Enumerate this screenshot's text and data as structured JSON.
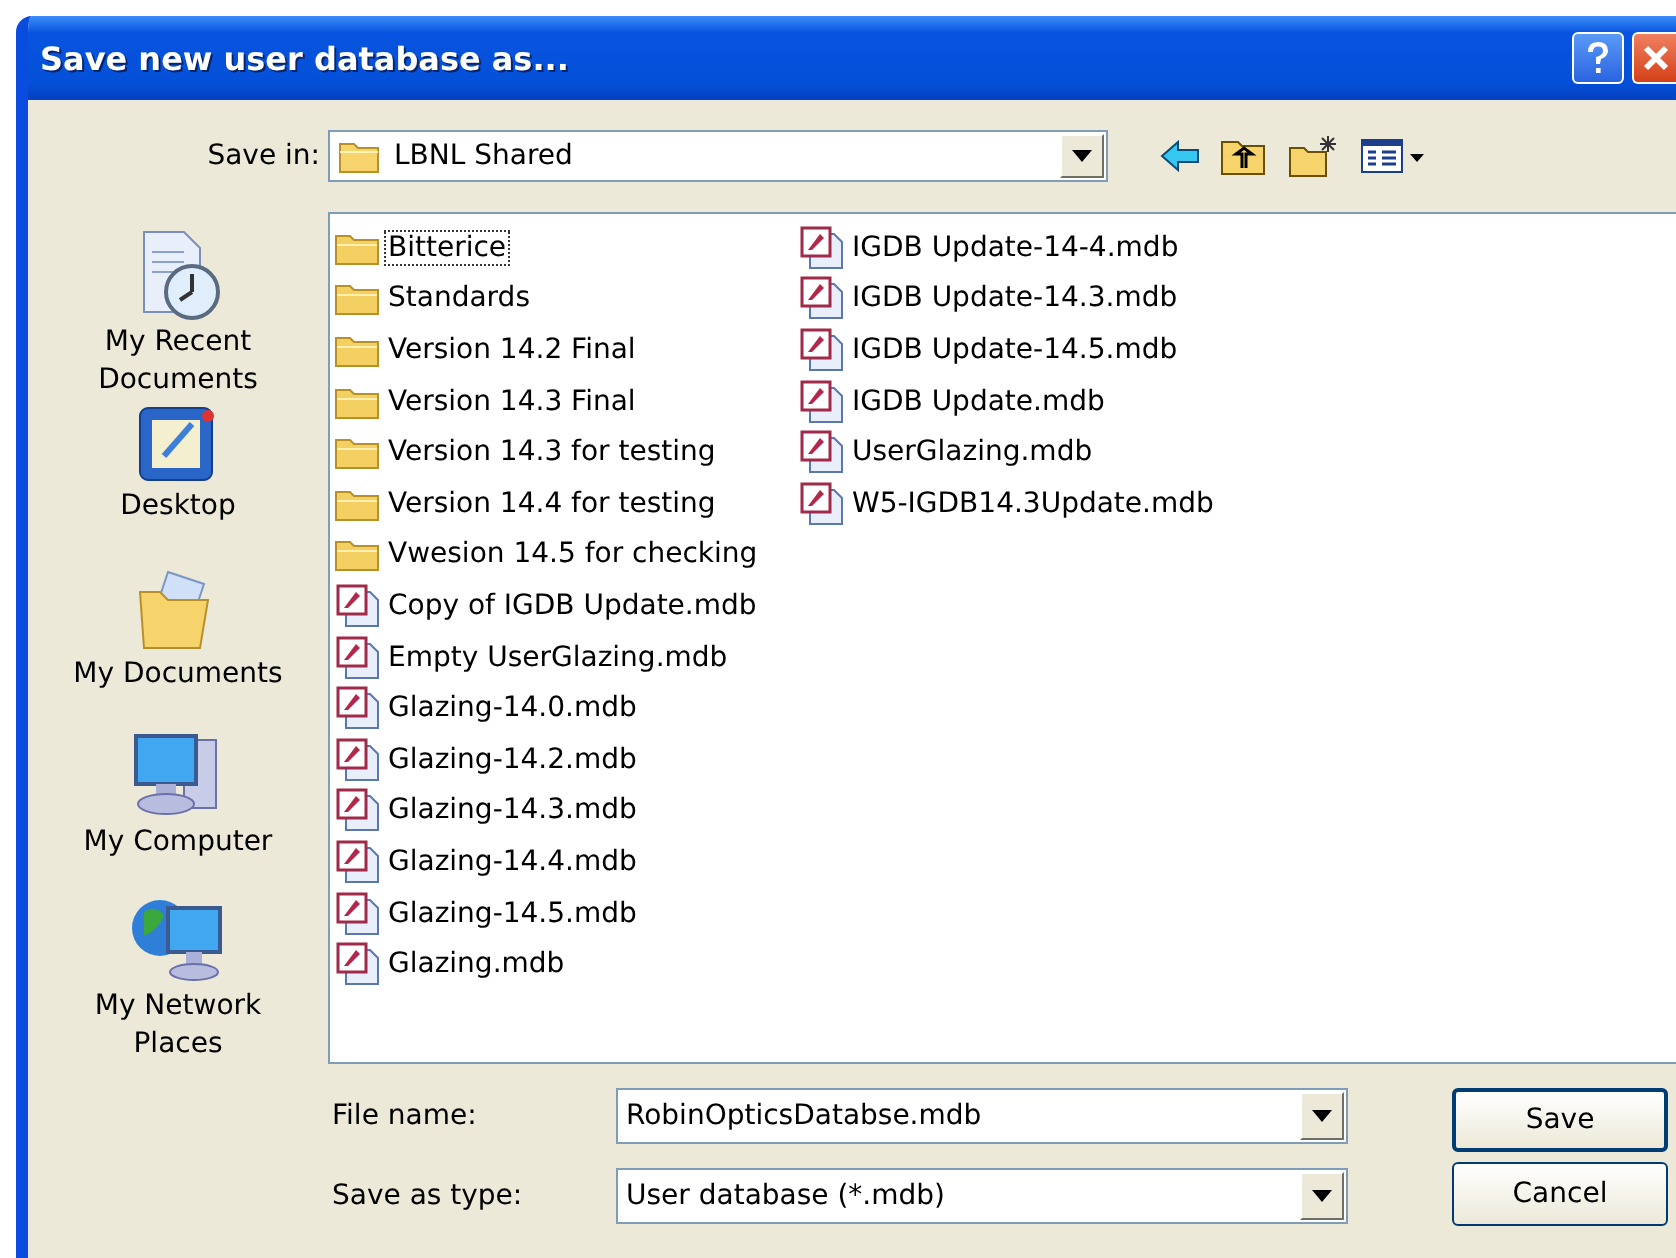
{
  "window": {
    "title": "Save new user database as..."
  },
  "save_in": {
    "label": "Save in:",
    "value": "LBNL Shared"
  },
  "places": [
    {
      "label": "My Recent Documents",
      "kind": "recent"
    },
    {
      "label": "Desktop",
      "kind": "desktop"
    },
    {
      "label": "My Documents",
      "kind": "documents"
    },
    {
      "label": "My Computer",
      "kind": "computer"
    },
    {
      "label": "My Network Places",
      "kind": "network"
    }
  ],
  "files": [
    {
      "name": "Bitterice",
      "kind": "folder",
      "focused": true
    },
    {
      "name": "Standards",
      "kind": "folder",
      "focused": false
    },
    {
      "name": "Version 14.2 Final",
      "kind": "folder",
      "focused": false
    },
    {
      "name": "Version 14.3 Final",
      "kind": "folder",
      "focused": false
    },
    {
      "name": "Version 14.3 for testing",
      "kind": "folder",
      "focused": false
    },
    {
      "name": "Version 14.4 for testing",
      "kind": "folder",
      "focused": false
    },
    {
      "name": "Vwesion 14.5 for checking",
      "kind": "folder",
      "focused": false
    },
    {
      "name": "Copy of IGDB Update.mdb",
      "kind": "mdb",
      "focused": false
    },
    {
      "name": "Empty UserGlazing.mdb",
      "kind": "mdb",
      "focused": false
    },
    {
      "name": "Glazing-14.0.mdb",
      "kind": "mdb",
      "focused": false
    },
    {
      "name": "Glazing-14.2.mdb",
      "kind": "mdb",
      "focused": false
    },
    {
      "name": "Glazing-14.3.mdb",
      "kind": "mdb",
      "focused": false
    },
    {
      "name": "Glazing-14.4.mdb",
      "kind": "mdb",
      "focused": false
    },
    {
      "name": "Glazing-14.5.mdb",
      "kind": "mdb",
      "focused": false
    },
    {
      "name": "Glazing.mdb",
      "kind": "mdb",
      "focused": false
    },
    {
      "name": "IGDB Update-14-4.mdb",
      "kind": "mdb",
      "focused": false
    },
    {
      "name": "IGDB Update-14.3.mdb",
      "kind": "mdb",
      "focused": false
    },
    {
      "name": "IGDB Update-14.5.mdb",
      "kind": "mdb",
      "focused": false
    },
    {
      "name": "IGDB Update.mdb",
      "kind": "mdb",
      "focused": false
    },
    {
      "name": "UserGlazing.mdb",
      "kind": "mdb",
      "focused": false
    },
    {
      "name": "W5-IGDB14.3Update.mdb",
      "kind": "mdb",
      "focused": false
    }
  ],
  "file_name": {
    "label": "File name:",
    "value": "RobinOpticsDatabse.mdb"
  },
  "save_as_type": {
    "label": "Save as type:",
    "value": "User database (*.mdb)"
  },
  "buttons": [
    {
      "label": "Save",
      "default": true
    },
    {
      "label": "Cancel",
      "default": false
    }
  ]
}
